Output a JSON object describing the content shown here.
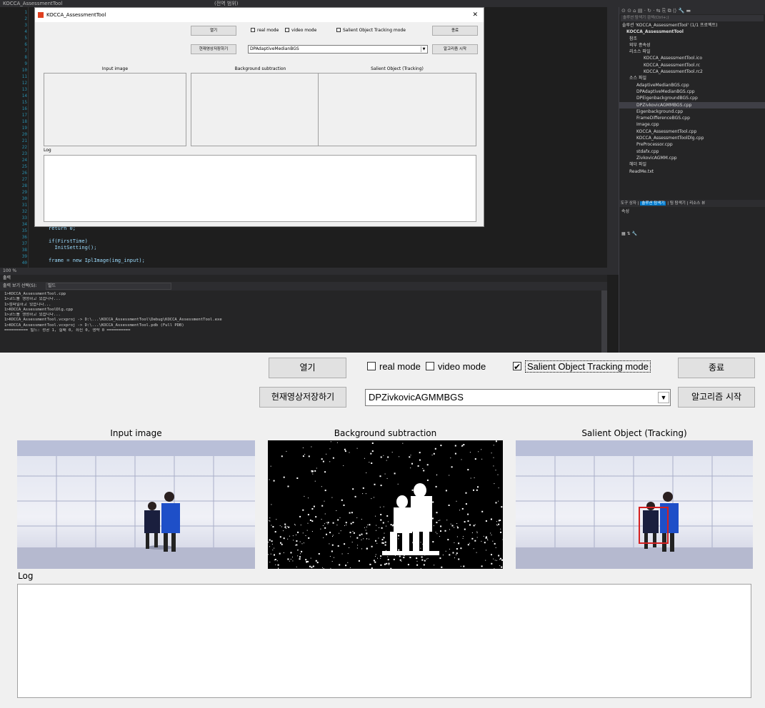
{
  "vs": {
    "title": "KOCCA_AssessmentTool",
    "editor_tab": "(전역 범위)",
    "zoom": "100 %",
    "line_numbers": [
      "1",
      "2",
      "3",
      "4",
      "5",
      "6",
      "7",
      "8",
      "9",
      "10",
      "11",
      "12",
      "13",
      "14",
      "15",
      "16",
      "17",
      "18",
      "19",
      "20",
      "21",
      "22",
      "23",
      "24",
      "25",
      "26",
      "27",
      "28",
      "29",
      "30",
      "31",
      "32",
      "33",
      "34",
      "35",
      "36",
      "37",
      "38",
      "39",
      "40"
    ],
    "code_lines": [
      "return 0;",
      "if(FirstTime)",
      "  InitSetting();",
      "frame = new IplImage(img_input);"
    ],
    "output": {
      "title": "출력",
      "source_label": "출력 보기 선택(S):",
      "source_value": "빌드",
      "lines": [
        "1>KOCCA_AssessmentTool.cpp",
        "1>코드를 생성하고 있습니다...",
        "1>컴파일하고 있습니다...",
        "1>KOCCA_AssessmentToolDlg.cpp",
        "1>코드를 생성하고 있습니다...",
        "1>KOCCA_AssessmentTool.vcxproj -> D:\\...\\KOCCA_AssessmentTool\\Debug\\KOCCA_AssessmentTool.exe",
        "1>KOCCA_AssessmentTool.vcxproj -> D:\\...\\KOCCA_AssessmentTool.pdb (Full PDB)",
        "========== 빌드: 성공 1, 실패 0, 최신 0, 생략 0 =========="
      ]
    },
    "solution": {
      "search": "솔루션 탐색기 검색(Ctrl+;)",
      "root": "솔루션 'KOCCA_AssessmentTool' (1/1 프로젝트)",
      "project": "KOCCA_AssessmentTool",
      "items": [
        {
          "label": "참조",
          "indent": 1
        },
        {
          "label": "외부 종속성",
          "indent": 1
        },
        {
          "label": "리소스 파일",
          "indent": 1
        },
        {
          "label": "KOCCA_AssessmentTool.ico",
          "indent": 3
        },
        {
          "label": "KOCCA_AssessmentTool.rc",
          "indent": 3
        },
        {
          "label": "KOCCA_AssessmentTool.rc2",
          "indent": 3
        },
        {
          "label": "소스 파일",
          "indent": 1
        },
        {
          "label": "AdaptiveMedianBGS.cpp",
          "indent": 2
        },
        {
          "label": "DPAdaptiveMedianBGS.cpp",
          "indent": 2
        },
        {
          "label": "DPEigenbackgroundBGS.cpp",
          "indent": 2
        },
        {
          "label": "DPZivkovicAGMMBGS.cpp",
          "indent": 2,
          "selected": true
        },
        {
          "label": "Eigenbackground.cpp",
          "indent": 2
        },
        {
          "label": "FrameDifferenceBGS.cpp",
          "indent": 2
        },
        {
          "label": "Image.cpp",
          "indent": 2
        },
        {
          "label": "KOCCA_AssessmentTool.cpp",
          "indent": 2
        },
        {
          "label": "KOCCA_AssessmentToolDlg.cpp",
          "indent": 2
        },
        {
          "label": "PreProcessor.cpp",
          "indent": 2
        },
        {
          "label": "stdafx.cpp",
          "indent": 2
        },
        {
          "label": "ZivkovicAGMM.cpp",
          "indent": 2
        },
        {
          "label": "헤더 파일",
          "indent": 1
        },
        {
          "label": "ReadMe.txt",
          "indent": 1
        }
      ],
      "tabs": [
        "도구 상자",
        "솔루션 탐색기",
        "팀 탐색기",
        "리소스 뷰"
      ],
      "properties_title": "속성"
    }
  },
  "small_dialog": {
    "title": "KOCCA_AssessmentTool",
    "open_label": "열기",
    "save_label": "현재영상저장하기",
    "real_mode": "real mode",
    "video_mode": "video mode",
    "salient_mode": "Salient Object Tracking mode",
    "exit_label": "종료",
    "algorithm_value": "DPAdaptiveMedianBGS",
    "start_label": "알고리즘 시작",
    "input_label": "Input image",
    "bg_label": "Background subtraction",
    "salient_label": "Salient Object (Tracking)",
    "log_label": "Log"
  },
  "dialog": {
    "open_label": "열기",
    "save_label": "현재영상저장하기",
    "real_mode_label": "real mode",
    "real_mode_checked": false,
    "video_mode_label": "video mode",
    "video_mode_checked": false,
    "salient_mode_label": "Salient Object Tracking mode",
    "salient_mode_checked": true,
    "exit_label": "종료",
    "algorithm_value": "DPZivkovicAGMMBGS",
    "start_label": "알고리즘 시작",
    "input_label": "Input image",
    "bg_label": "Background subtraction",
    "salient_label": "Salient Object (Tracking)",
    "log_label": "Log",
    "log_text": ""
  },
  "colors": {
    "vs_bg": "#1e1e1e",
    "tracking_box": "#d42020",
    "coat_blue": "#1e4fc8",
    "coat_navy": "#1a1f3e"
  }
}
